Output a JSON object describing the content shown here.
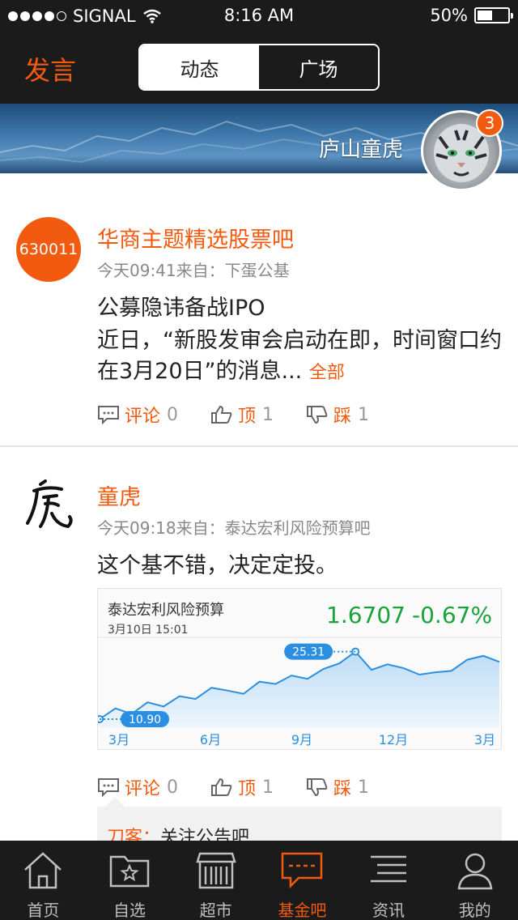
{
  "status_bar": {
    "carrier": "SIGNAL",
    "time": "8:16 AM",
    "battery": "50%"
  },
  "nav": {
    "post_label": "发言",
    "segments": [
      "动态",
      "广场"
    ],
    "active_segment": 0
  },
  "profile": {
    "username": "庐山童虎",
    "notification_count": "3"
  },
  "posts": [
    {
      "avatar_text": "630011",
      "title": "华商主题精选股票吧",
      "meta": "今天09:41来自：下蛋公基",
      "headline": "公募隐讳备战IPO",
      "body": "近日，“新股发审会启动在即，时间窗口约在3月20日”的消息...",
      "more": "全部",
      "actions": {
        "comment_label": "评论",
        "comment_count": "0",
        "up_label": "顶",
        "up_count": "1",
        "down_label": "踩",
        "down_count": "1"
      }
    },
    {
      "avatar_icon": "calligraphy-tiger-avatar",
      "title": "童虎",
      "meta": "今天09:18来自：泰达宏利风险预算吧",
      "body": "这个基不错，决定定投。",
      "fund_card": {
        "name": "泰达宏利风险预算",
        "date": "3月10日 15:01",
        "nav": "1.6707",
        "change": "-0.67%"
      },
      "actions": {
        "comment_label": "评论",
        "comment_count": "0",
        "up_label": "顶",
        "up_count": "1",
        "down_label": "踩",
        "down_count": "1"
      },
      "reply": {
        "name": "刀客：",
        "text": "关注公告吧"
      }
    }
  ],
  "chart_data": {
    "type": "area",
    "title": "泰达宏利风险预算",
    "x": [
      "3月",
      "",
      "",
      "6月",
      "",
      "",
      "9月",
      "",
      "",
      "12月",
      "",
      "",
      "3月"
    ],
    "x_labels": [
      "3月",
      "6月",
      "9月",
      "12月",
      "3月"
    ],
    "series": [
      {
        "values": [
          10.9,
          13.2,
          12.0,
          14.5,
          13.6,
          15.8,
          15.2,
          17.6,
          17.0,
          16.3,
          18.9,
          18.4,
          20.2,
          19.5,
          21.6,
          22.8,
          25.31,
          21.4,
          22.6,
          21.8,
          20.4,
          20.9,
          21.2,
          23.6,
          24.4,
          23.1
        ]
      }
    ],
    "min_label": "10.90",
    "max_label": "25.31",
    "ylim": [
      9,
      28
    ],
    "color": "#2a8fe0"
  },
  "tabbar": {
    "tabs": [
      "首页",
      "自选",
      "超市",
      "基金吧",
      "资讯",
      "我的"
    ],
    "active": 3
  },
  "colors": {
    "accent": "#f25a0f",
    "dark_bar": "#1b1b1b",
    "positive_green": "#1aa33b",
    "chart_blue": "#2a8fe0"
  }
}
